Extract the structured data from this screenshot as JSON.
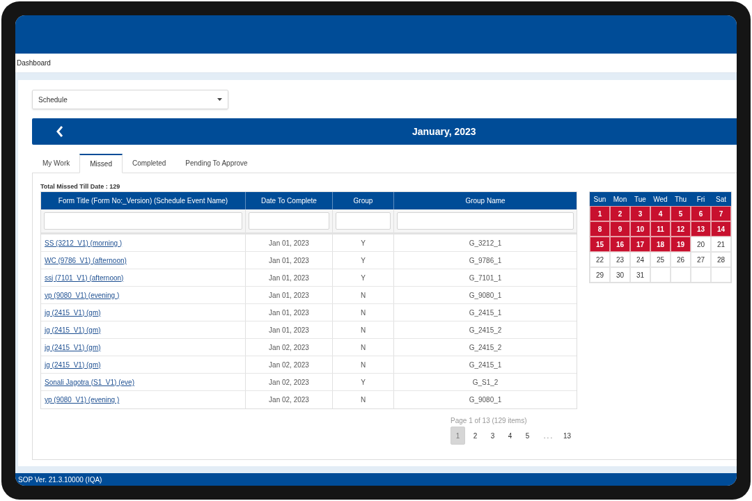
{
  "breadcrumb": "Dashboard",
  "schedule_select": {
    "value": "Schedule"
  },
  "month_bar": {
    "title": "January, 2023"
  },
  "tabs": [
    {
      "label": "My Work",
      "selected": false
    },
    {
      "label": "Missed",
      "selected": true
    },
    {
      "label": "Completed",
      "selected": false
    },
    {
      "label": "Pending To Approve",
      "selected": false
    }
  ],
  "summary": "Total Missed Till Date : 129",
  "table": {
    "columns": [
      "Form Title (Form No:_Version) (Schedule Event Name)",
      "Date To Complete",
      "Group",
      "Group Name"
    ],
    "rows": [
      {
        "form_title": "SS (3212_V1) (morning )",
        "date": "Jan 01, 2023",
        "group": "Y",
        "group_name": "G_3212_1"
      },
      {
        "form_title": "WC (9786_V1) (afternoon)",
        "date": "Jan 01, 2023",
        "group": "Y",
        "group_name": "G_9786_1"
      },
      {
        "form_title": "ssj (7101_V1) (afternoon)",
        "date": "Jan 01, 2023",
        "group": "Y",
        "group_name": "G_7101_1"
      },
      {
        "form_title": "yp (9080_V1) (evening )",
        "date": "Jan 01, 2023",
        "group": "N",
        "group_name": "G_9080_1"
      },
      {
        "form_title": "jg (2415_V1) (gm)",
        "date": "Jan 01, 2023",
        "group": "N",
        "group_name": "G_2415_1"
      },
      {
        "form_title": "jg (2415_V1) (gm)",
        "date": "Jan 01, 2023",
        "group": "N",
        "group_name": "G_2415_2"
      },
      {
        "form_title": "jg (2415_V1) (gm)",
        "date": "Jan 02, 2023",
        "group": "N",
        "group_name": "G_2415_2"
      },
      {
        "form_title": "jg (2415_V1) (gm)",
        "date": "Jan 02, 2023",
        "group": "N",
        "group_name": "G_2415_1"
      },
      {
        "form_title": "Sonali Jagotra  (S1_V1) (eve)",
        "date": "Jan 02, 2023",
        "group": "Y",
        "group_name": "G_S1_2"
      },
      {
        "form_title": "yp (9080_V1) (evening )",
        "date": "Jan 02, 2023",
        "group": "N",
        "group_name": "G_9080_1"
      }
    ]
  },
  "calendar": {
    "weekdays": [
      "Sun",
      "Mon",
      "Tue",
      "Wed",
      "Thu",
      "Fri",
      "Sat"
    ],
    "days": [
      {
        "label": "1",
        "missed": true
      },
      {
        "label": "2",
        "missed": true
      },
      {
        "label": "3",
        "missed": true
      },
      {
        "label": "4",
        "missed": true
      },
      {
        "label": "5",
        "missed": true
      },
      {
        "label": "6",
        "missed": true
      },
      {
        "label": "7",
        "missed": true
      },
      {
        "label": "8",
        "missed": true
      },
      {
        "label": "9",
        "missed": true
      },
      {
        "label": "10",
        "missed": true
      },
      {
        "label": "11",
        "missed": true
      },
      {
        "label": "12",
        "missed": true
      },
      {
        "label": "13",
        "missed": true
      },
      {
        "label": "14",
        "missed": true
      },
      {
        "label": "15",
        "missed": true
      },
      {
        "label": "16",
        "missed": true
      },
      {
        "label": "17",
        "missed": true
      },
      {
        "label": "18",
        "missed": true
      },
      {
        "label": "19",
        "missed": true
      },
      {
        "label": "20",
        "missed": false
      },
      {
        "label": "21",
        "missed": false
      },
      {
        "label": "22",
        "missed": false
      },
      {
        "label": "23",
        "missed": false
      },
      {
        "label": "24",
        "missed": false
      },
      {
        "label": "25",
        "missed": false
      },
      {
        "label": "26",
        "missed": false
      },
      {
        "label": "27",
        "missed": false
      },
      {
        "label": "28",
        "missed": false
      },
      {
        "label": "29",
        "missed": false
      },
      {
        "label": "30",
        "missed": false
      },
      {
        "label": "31",
        "missed": false
      }
    ]
  },
  "pagination": {
    "summary": "Page 1 of 13 (129 items)",
    "pages": [
      {
        "label": "1",
        "selected": true,
        "kind": "page"
      },
      {
        "label": "2",
        "selected": false,
        "kind": "page"
      },
      {
        "label": "3",
        "selected": false,
        "kind": "page"
      },
      {
        "label": "4",
        "selected": false,
        "kind": "page"
      },
      {
        "label": "5",
        "selected": false,
        "kind": "page"
      },
      {
        "label": "...",
        "kind": "ellipsis"
      },
      {
        "label": "13",
        "selected": false,
        "kind": "page"
      }
    ]
  },
  "footer": "SOP Ver. 21.3.10000 (IQA)"
}
